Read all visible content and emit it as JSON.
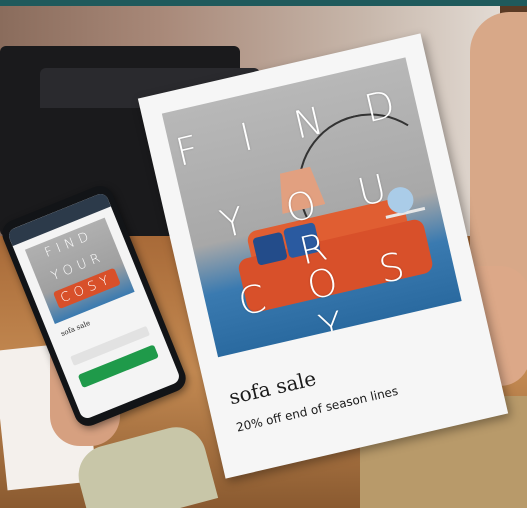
{
  "poster": {
    "title_line1": "F I N D",
    "title_line2": "Y O U R",
    "title_line3": "C O S Y",
    "heading": "sofa sale",
    "subheading": "20% off end of season lines"
  },
  "phone": {
    "app_bar_text": "",
    "title_line1": "FIND",
    "title_line2": "YOUR",
    "title_line3": "COSY",
    "heading": "sofa sale",
    "button_label": ""
  },
  "colors": {
    "top_bar": "#1f5a5c",
    "sofa": "#d8502a",
    "poster_paper": "#f6f6f6",
    "phone_button": "#1f9a4a"
  }
}
